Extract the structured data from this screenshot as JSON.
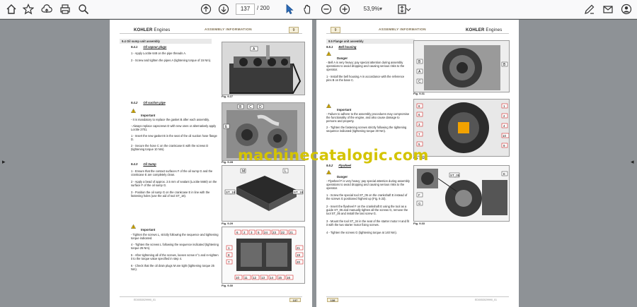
{
  "toolbar": {
    "page_current": "137",
    "page_total": "/ 200",
    "zoom": "53,9%"
  },
  "icons": {
    "home": "home-icon",
    "bookmark": "star-icon",
    "upload": "cloud-upload-icon",
    "print": "print-icon",
    "search": "zoom-icon",
    "prev": "page-up-icon",
    "next": "page-down-icon",
    "select": "cursor-icon",
    "hand": "hand-icon",
    "zoom_out": "minus-circle-icon",
    "zoom_in": "plus-circle-icon",
    "fit": "fit-page-icon",
    "sign": "pen-icon",
    "mail": "mail-icon",
    "account": "account-icon"
  },
  "left_page": {
    "brand": "KOHLER",
    "brand_suffix": "Engines",
    "title": "ASSEMBLY INFORMATION",
    "chapter": "9",
    "band": "9.4 Oil sump unit assembly",
    "s1_num": "9.4.1",
    "s1_title": "Oil vapour plugs",
    "s1_step1": "1 -  Apply Loctite 648 on the pipe threads A.",
    "s1_step2": "2 -  Screw and tighten the pipes A (tightening torque of 15 Nm).",
    "fig1": "Fig. 9.27",
    "s2_num": "9.4.2",
    "s2_title": "Oil suction pipe",
    "important1": "Important",
    "imp1_a": "- It is mandatory to replace the gasket B after each assembly.",
    "imp1_b": "- Always replace capscrews D with new ones or alternatively apply Loctite 2701.",
    "s2_step1": "1 -  Insert the new gasket B in the seat of the oil suction hose flange D.",
    "s2_step2": "2 -  Secure the hose C on the crankcase E with the screws D (tightening torque 10 Nm).",
    "fig2": "Fig. 9.28",
    "s3_num": "9.4.3",
    "s3_title": "Oil Sump",
    "s3_step1": "1 -  Ensure that the contact surfaces F of the oil sump G and the crankcase E are completely clean.",
    "s3_step2": "2 -  Apply a bead of approx. 2.5 mm of sealant (Loctite 5660) on the surface F of the oil sump G.",
    "s3_step3": "3 -  Position the oil sump G on the crankcase E in line with the fastening holes (use the aid of tool ST_18).",
    "fig3": "Fig. 9.29",
    "important2": "Important",
    "imp2_a": "- Tighten the screws L, strictly following the sequence and tightening torque indicated.",
    "s3_step4": "4 -  Tighten the screws L following the sequence indicated (tightening torque 25 Nm).",
    "s3_step5": "5 -  After tightening all of the screws, loosen screw n°1 and re-tighten it to the torque value specified in step 4.",
    "s3_step6": "6 -  Check that the oil drain plugs M are tight (tightening torque 25 Nm).",
    "fig4": "Fig. 9.30",
    "footer_code": "ED0053029990_01",
    "page_num": "137"
  },
  "right_page": {
    "chapter": "9",
    "title": "ASSEMBLY INFORMATION",
    "brand": "KOHLER",
    "brand_suffix": "Engines",
    "band": "9.5 Flange unit assembly",
    "s1_num": "9.5.1",
    "s1_title": "Bell housing",
    "danger1": "Danger",
    "dng1": "- Bell A is very heavy; pay special attention during assembly operations to avoid dropping and causing serious risks to the operator.",
    "s1_step1": "1 -  Install the bell housing A in accordance with the reference pins B on the base C.",
    "fig1": "Fig. 9.31",
    "important1": "Important",
    "imp1": "- Failure to adhere to the assembly procedures may compromise the functionality of the engine, and also cause damage to persons and property.",
    "s1_step2": "2 -  Tighten the fastening screws strictly following the tightening sequence indicated (tightening torque 30 Nm).",
    "fig2": "Fig. 9.32",
    "s2_num": "9.5.2",
    "s2_title": "Flywheel",
    "danger2": "Danger",
    "dng2": "- Flywheel F is very heavy; pay special attention during assembly operations to avoid dropping and causing serious risks to the operator.",
    "s2_step1": "1 -  Screw the special tool ST_05 on the crankshaft E instead of the screws G positioned highest up (Fig. 9.33).",
    "s2_step2": "2 -  Insert the flywheel F on the crankshaft E using the tool as a guide ST_05 and manually tighten all the screws G, remove the tool ST_05 and install the last screw G.",
    "s2_step3": "3 -  Mount the tool ST_34 in the seat of the starter motor H and fit it with the two starter motor fixing screws.",
    "s2_step4": "4 -  Tighten the screws G (tightening torque at 140 Nm).",
    "fig3": "Fig. 9.33",
    "footer_code": "ED0053029990_01",
    "page_num": "138"
  },
  "watermark": "machinecatalogic.com",
  "colors": {
    "toolbar_bg": "#f9f9fa",
    "viewer_bg": "#8e9296",
    "accent_gold": "#bfae7a",
    "watermark": "#d4c400"
  }
}
